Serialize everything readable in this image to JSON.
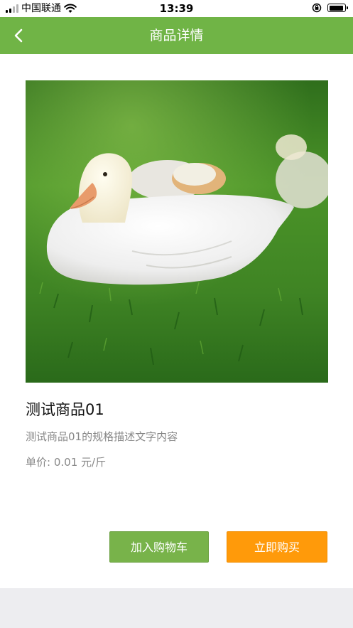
{
  "status_bar": {
    "carrier": "中国联通",
    "time": "13:39",
    "icons": [
      "signal-icon",
      "wifi-icon",
      "orientation-lock-icon",
      "battery-icon"
    ]
  },
  "navbar": {
    "title": "商品详情",
    "back_icon": "back-chevron-icon"
  },
  "product": {
    "name": "测试商品01",
    "description": "测试商品01的规格描述文字内容",
    "price_label": "单价:",
    "price_value": "0.01 元/斤",
    "image_subject": "white gosling on grass"
  },
  "actions": {
    "add_to_cart": "加入购物车",
    "buy_now": "立即购买"
  },
  "colors": {
    "brand_green": "#70b446",
    "cart_button": "#78b34a",
    "buy_button": "#ff9a0a",
    "page_bg": "#ededf0"
  }
}
